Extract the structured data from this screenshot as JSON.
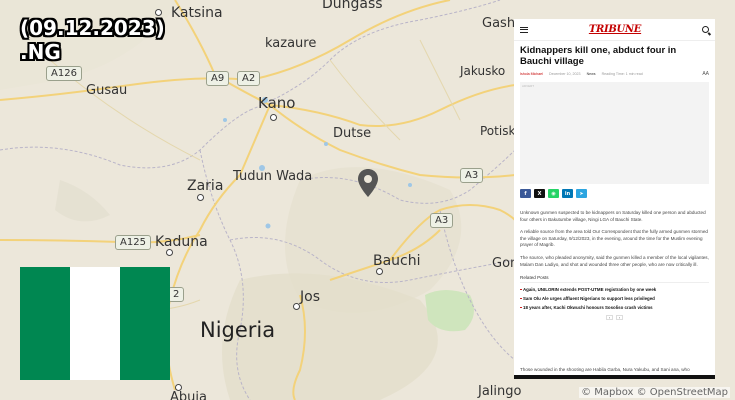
{
  "overlay": {
    "date_title_line1": "(09.12.2023)",
    "date_title_line2": ".NG"
  },
  "flag": {
    "colors": [
      "#008751",
      "#ffffff",
      "#008751"
    ]
  },
  "map": {
    "cities": {
      "katsina": "Katsina",
      "dungass": "Dungass",
      "gashua": "Gashu",
      "kazaure": "kazaure",
      "gusau": "Gusau",
      "kano": "Kano",
      "jakusko": "Jakusko",
      "dutse": "Dutse",
      "potiskum": "Potisk",
      "tudun_wada": "Tudun Wada",
      "zaria": "Zaria",
      "kaduna": "Kaduna",
      "bauchi": "Bauchi",
      "gombe": "Gomb",
      "jos": "Jos",
      "nigeria": "Nigeria",
      "abuja": "Abuja",
      "jalingo": "Jalingo"
    },
    "highways": {
      "a126": "A126",
      "a9": "A9",
      "a2": "A2",
      "a3_right": "A3",
      "a3_mid": "A3",
      "a125": "A125",
      "a2_low": "2"
    },
    "attribution": "© Mapbox © OpenStreetMap"
  },
  "article": {
    "logo": "TRIBUNE",
    "headline": "Kidnappers kill one, abduct four in Bauchi village",
    "author": "Ishola Michael",
    "date": "December 10, 2023",
    "section": "News",
    "reading_time": "Reading Time: 1 min read",
    "font_size_icon": "AA",
    "image_caption": "ADVERT",
    "paragraphs": [
      "Unknown gunmen suspected to be kidnappers on Saturday killed one person and abducted four others in Bakutumbe village, Ningi LGA of Bauchi State.",
      "A reliable source from the area told Our Correspondent that the fully armed gunmen stormed the village on Saturday, 9/12/2023, in the evening, around the time for the Muslim evening prayer of Magrib.",
      "The source, who pleaded anonymity, said the gunmen killed a member of the local vigilantes, Malam Dan Ladiyo, and shot and wounded three other people, who are now critically ill."
    ],
    "related_title": "Related Posts",
    "related": [
      "Again, UNILORIN extends POST-UTME registration by one week",
      "Sam Olu Ale urges affluent Nigerians to support less privileged",
      "18 years after, Kachi Okwuchi honours Sosoliso crash victims"
    ],
    "pager": [
      "‹",
      "›"
    ],
    "bottom_paragraph": "Those wounded in the shooting are Habila Garba, Nura Yakubu, and Sani ana, who",
    "share_buttons": [
      {
        "name": "facebook",
        "glyph": "f",
        "color": "#3b5998"
      },
      {
        "name": "x",
        "glyph": "X",
        "color": "#111111"
      },
      {
        "name": "whatsapp",
        "glyph": "◉",
        "color": "#25d366"
      },
      {
        "name": "linkedin",
        "glyph": "in",
        "color": "#0077b5"
      },
      {
        "name": "telegram",
        "glyph": "➤",
        "color": "#2ca5e0"
      }
    ]
  }
}
